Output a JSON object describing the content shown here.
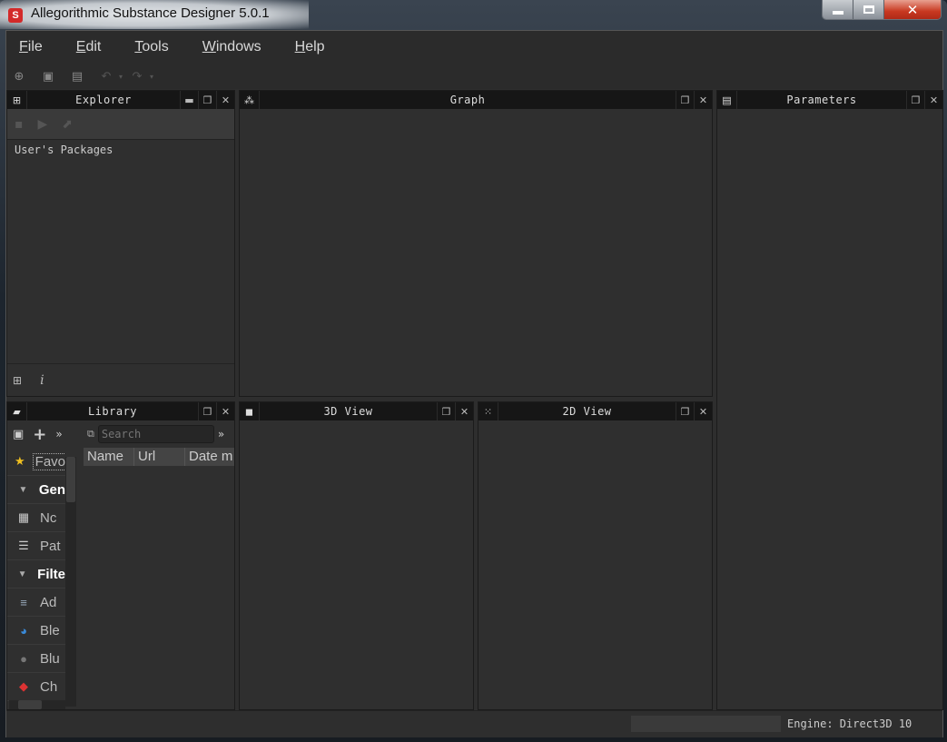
{
  "window": {
    "title": "Allegorithmic Substance Designer 5.0.1",
    "app_icon": "S",
    "controls": {
      "minimize": "minimize-icon",
      "maximize": "maximize-icon",
      "close": "close-icon"
    }
  },
  "menubar": {
    "items": [
      {
        "label": "File",
        "mnemonic": "F",
        "rest": "ile"
      },
      {
        "label": "Edit",
        "mnemonic": "E",
        "rest": "dit"
      },
      {
        "label": "Tools",
        "mnemonic": "T",
        "rest": "ools"
      },
      {
        "label": "Windows",
        "mnemonic": "W",
        "rest": "indows"
      },
      {
        "label": "Help",
        "mnemonic": "H",
        "rest": "elp"
      }
    ]
  },
  "toolbar": {
    "icons": [
      "new-package-icon",
      "open-package-icon",
      "save-all-icon",
      "undo-icon",
      "redo-icon"
    ]
  },
  "panels": {
    "explorer": {
      "title": "Explorer",
      "root_item": "User's Packages"
    },
    "graph": {
      "title": "Graph"
    },
    "parameters": {
      "title": "Parameters"
    },
    "library": {
      "title": "Library",
      "search_placeholder": "Search",
      "columns": [
        "Name",
        "Url",
        "Date m"
      ],
      "items": [
        {
          "label": "Favo",
          "type": "favorite",
          "icon": "★"
        },
        {
          "label": "Gen",
          "type": "category"
        },
        {
          "label": "Nc",
          "type": "item",
          "icon": "▦"
        },
        {
          "label": "Pat",
          "type": "item",
          "icon": "☰"
        },
        {
          "label": "Filte",
          "type": "category"
        },
        {
          "label": "Ad",
          "type": "item",
          "icon": "≡"
        },
        {
          "label": "Ble",
          "type": "item",
          "icon": "◕"
        },
        {
          "label": "Blu",
          "type": "item",
          "icon": "●"
        },
        {
          "label": "Ch",
          "type": "item",
          "icon": "◆"
        }
      ]
    },
    "view3d": {
      "title": "3D View"
    },
    "view2d": {
      "title": "2D View"
    }
  },
  "statusbar": {
    "engine": "Engine: Direct3D 10"
  }
}
